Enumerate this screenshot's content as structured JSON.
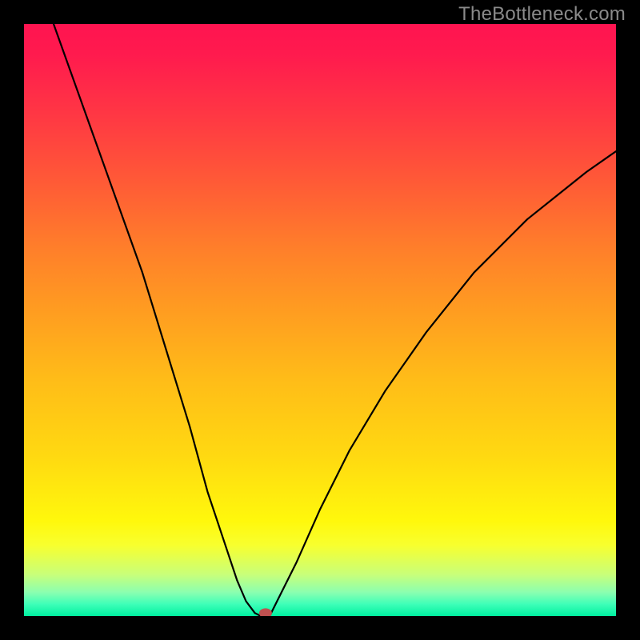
{
  "watermark": {
    "text": "TheBottleneck.com"
  },
  "chart_data": {
    "type": "line",
    "title": "",
    "xlabel": "",
    "ylabel": "",
    "xlim": [
      0,
      1
    ],
    "ylim": [
      0,
      100
    ],
    "grid": false,
    "legend": null,
    "series": [
      {
        "name": "curve-left",
        "x": [
          0.05,
          0.1,
          0.15,
          0.2,
          0.24,
          0.28,
          0.31,
          0.34,
          0.36,
          0.375,
          0.39
        ],
        "y": [
          100.0,
          86.0,
          72.0,
          58.0,
          45.0,
          32.0,
          21.0,
          12.0,
          6.0,
          2.5,
          0.5
        ]
      },
      {
        "name": "flat-bottom",
        "x": [
          0.39,
          0.4,
          0.415
        ],
        "y": [
          0.5,
          0.0,
          0.0
        ]
      },
      {
        "name": "curve-right",
        "x": [
          0.415,
          0.43,
          0.46,
          0.5,
          0.55,
          0.61,
          0.68,
          0.76,
          0.85,
          0.95,
          1.0
        ],
        "y": [
          0.0,
          3.0,
          9.0,
          18.0,
          28.0,
          38.0,
          48.0,
          58.0,
          67.0,
          75.0,
          78.5
        ]
      }
    ],
    "marker": {
      "x": 0.408,
      "y": 0.0,
      "rx": 8,
      "ry": 6
    },
    "background": {
      "type": "vertical-gradient",
      "scale": "bottleneck-percent",
      "stops": [
        {
          "pos": 0.0,
          "color": "#ff1450"
        },
        {
          "pos": 0.38,
          "color": "#ff7f2a"
        },
        {
          "pos": 0.84,
          "color": "#fff80c"
        },
        {
          "pos": 1.0,
          "color": "#00f0a0"
        }
      ]
    }
  }
}
